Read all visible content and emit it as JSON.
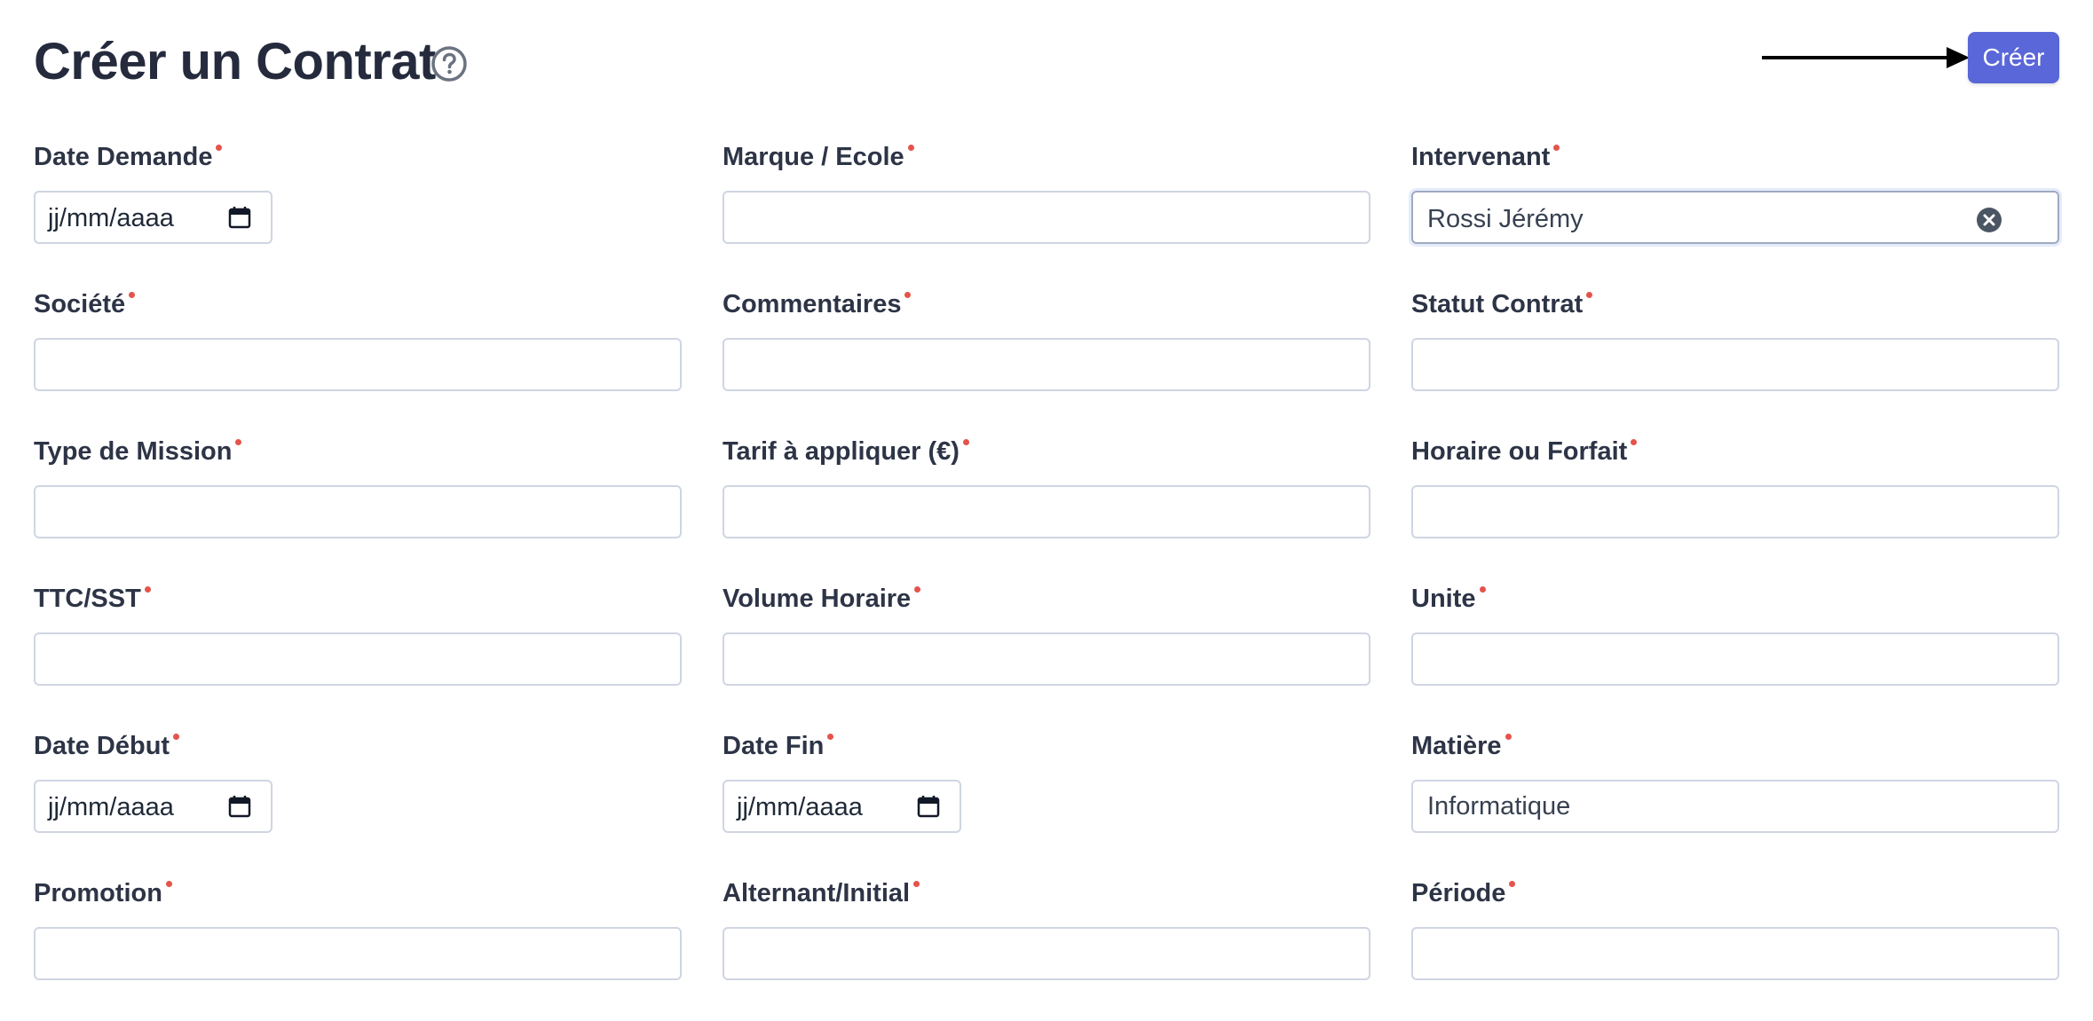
{
  "header": {
    "title": "Créer un Contrat",
    "create_label": "Créer"
  },
  "fields": {
    "date_demande": {
      "label": "Date Demande",
      "placeholder": "jj/mm/aaaa"
    },
    "marque_ecole": {
      "label": "Marque / Ecole",
      "value": ""
    },
    "intervenant": {
      "label": "Intervenant",
      "value": "Rossi Jérémy"
    },
    "societe": {
      "label": "Société",
      "value": ""
    },
    "commentaires": {
      "label": "Commentaires",
      "value": ""
    },
    "statut_contrat": {
      "label": "Statut Contrat",
      "value": ""
    },
    "type_mission": {
      "label": "Type de Mission",
      "value": ""
    },
    "tarif": {
      "label": "Tarif à appliquer (€)",
      "value": ""
    },
    "horaire_forfait": {
      "label": "Horaire ou Forfait",
      "value": ""
    },
    "ttc_sst": {
      "label": "TTC/SST",
      "value": ""
    },
    "volume_horaire": {
      "label": "Volume Horaire",
      "value": ""
    },
    "unite": {
      "label": "Unite",
      "value": ""
    },
    "date_debut": {
      "label": "Date Début",
      "placeholder": "jj/mm/aaaa"
    },
    "date_fin": {
      "label": "Date Fin",
      "placeholder": "jj/mm/aaaa"
    },
    "matiere": {
      "label": "Matière",
      "value": "Informatique"
    },
    "promotion": {
      "label": "Promotion",
      "value": ""
    },
    "alternant_initial": {
      "label": "Alternant/Initial",
      "value": ""
    },
    "periode": {
      "label": "Période",
      "value": ""
    }
  },
  "colors": {
    "primary_button": "#5a67d8",
    "required_marker": "#e5534b",
    "title_text": "#252b3d",
    "input_border": "#cfd5e2"
  },
  "icons": {
    "help": "help-circle-icon",
    "arrow": "arrow-right-icon",
    "calendar": "calendar-icon",
    "clear": "clear-circle-icon"
  }
}
